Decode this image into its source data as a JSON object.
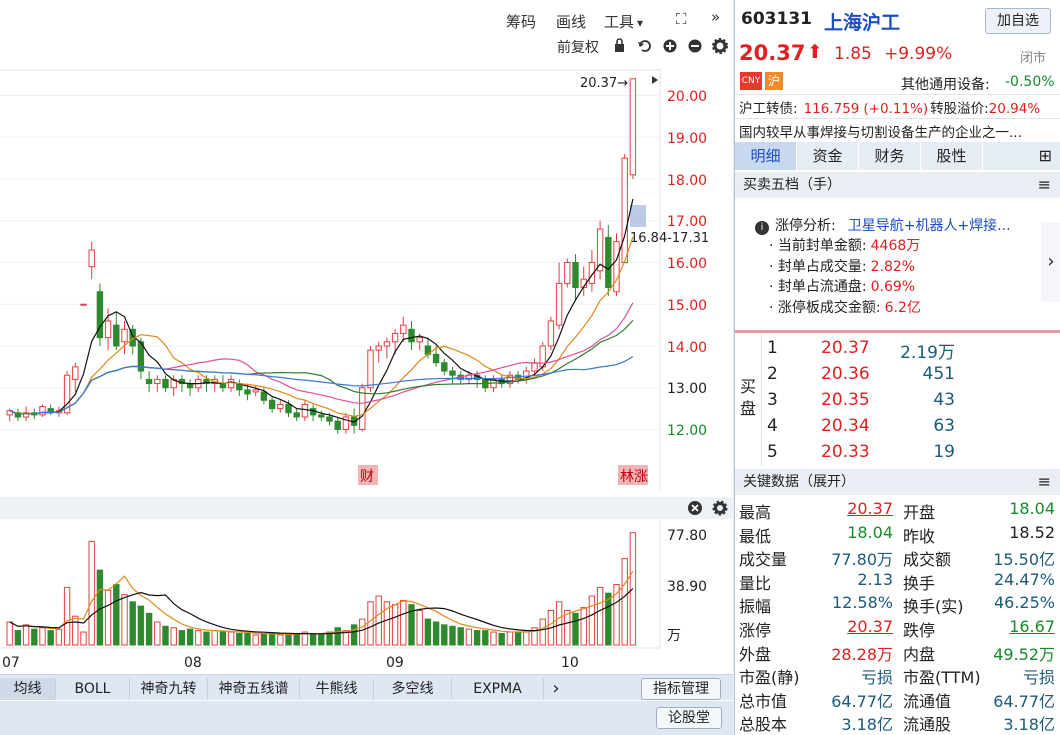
{
  "toolbar": {
    "chips": "筹码",
    "draw": "画线",
    "tools": "工具",
    "tools_arrow": "▾",
    "expand_icon": "⛶",
    "more_icon": "»",
    "adjust": "前复权"
  },
  "chart": {
    "y_labels": [
      "20.00",
      "19.00",
      "18.00",
      "17.00",
      "16.00",
      "15.00",
      "14.00",
      "13.00",
      "12.00"
    ],
    "last_price_tag": "20.37→",
    "range_tag": "16.84-17.31",
    "markers": [
      {
        "text": "财"
      },
      {
        "text": "林涨"
      }
    ],
    "volume_labels": [
      "77.80",
      "38.90",
      "万"
    ],
    "x_labels": [
      "07",
      "08",
      "09",
      "10"
    ],
    "chart_data": {
      "type": "candlestick",
      "title": "",
      "ylim": [
        11.6,
        20.5
      ],
      "volume_ylim": [
        0,
        77.8
      ],
      "candles": [
        [
          12.35,
          12.45,
          12.2,
          12.5,
          16
        ],
        [
          12.4,
          12.3,
          12.2,
          12.5,
          10
        ],
        [
          12.3,
          12.4,
          12.2,
          12.55,
          14
        ],
        [
          12.4,
          12.35,
          12.25,
          12.5,
          11
        ],
        [
          12.35,
          12.55,
          12.3,
          12.6,
          12
        ],
        [
          12.5,
          12.4,
          12.35,
          12.6,
          10
        ],
        [
          12.4,
          12.45,
          12.3,
          12.55,
          11
        ],
        [
          12.4,
          13.3,
          12.35,
          13.4,
          40
        ],
        [
          13.2,
          13.5,
          12.9,
          13.6,
          20
        ],
        [
          15,
          15,
          15,
          15,
          9
        ],
        [
          15.9,
          16.3,
          15.6,
          16.5,
          72
        ],
        [
          15.3,
          14.2,
          14.0,
          15.5,
          52
        ],
        [
          14.2,
          14.6,
          13.9,
          14.9,
          38
        ],
        [
          14.5,
          14.0,
          13.9,
          14.8,
          42
        ],
        [
          14.1,
          14.4,
          13.8,
          14.6,
          35
        ],
        [
          14.4,
          14.0,
          13.8,
          14.5,
          30
        ],
        [
          14.1,
          13.4,
          13.2,
          14.2,
          27
        ],
        [
          13.2,
          13.1,
          12.9,
          13.4,
          22
        ],
        [
          13.1,
          13.2,
          12.9,
          13.3,
          16
        ],
        [
          13.2,
          13.0,
          12.9,
          13.3,
          13
        ],
        [
          13.0,
          13.2,
          12.8,
          13.3,
          12
        ],
        [
          13.2,
          13.1,
          12.9,
          13.3,
          10
        ],
        [
          13.1,
          13.0,
          12.8,
          13.2,
          11
        ],
        [
          13.0,
          13.2,
          12.9,
          13.3,
          10
        ],
        [
          13.2,
          13.1,
          12.9,
          13.3,
          9
        ],
        [
          13.1,
          13.2,
          12.9,
          13.3,
          10
        ],
        [
          13.1,
          13.0,
          12.9,
          13.3,
          9
        ],
        [
          13.0,
          13.2,
          12.9,
          13.3,
          9
        ],
        [
          13.1,
          12.95,
          12.8,
          13.2,
          8
        ],
        [
          12.95,
          12.85,
          12.7,
          13.1,
          8
        ],
        [
          12.9,
          12.95,
          12.8,
          13.05,
          7
        ],
        [
          12.9,
          12.7,
          12.6,
          13.0,
          8
        ],
        [
          12.7,
          12.5,
          12.4,
          12.8,
          8
        ],
        [
          12.5,
          12.6,
          12.4,
          12.7,
          7
        ],
        [
          12.6,
          12.4,
          12.3,
          12.7,
          7
        ],
        [
          12.4,
          12.3,
          12.2,
          12.5,
          8
        ],
        [
          12.3,
          12.6,
          12.2,
          12.7,
          9
        ],
        [
          12.5,
          12.35,
          12.2,
          12.6,
          8
        ],
        [
          12.35,
          12.3,
          12.2,
          12.45,
          8
        ],
        [
          12.3,
          12.2,
          12.1,
          12.4,
          9
        ],
        [
          12.2,
          12.0,
          11.9,
          12.3,
          12
        ],
        [
          12.0,
          12.3,
          11.9,
          12.4,
          10
        ],
        [
          12.3,
          12.1,
          11.9,
          12.5,
          14
        ],
        [
          12.0,
          13.0,
          11.95,
          13.1,
          18
        ],
        [
          13.0,
          13.9,
          12.9,
          14.0,
          30
        ],
        [
          13.9,
          14.0,
          13.6,
          14.1,
          34
        ],
        [
          14.0,
          14.1,
          13.7,
          14.2,
          30
        ],
        [
          14.1,
          14.3,
          13.8,
          14.4,
          28
        ],
        [
          14.3,
          14.5,
          14.1,
          14.7,
          31
        ],
        [
          14.4,
          14.1,
          13.9,
          14.6,
          28
        ],
        [
          14.1,
          14.2,
          13.9,
          14.3,
          24
        ],
        [
          14.0,
          13.8,
          13.7,
          14.2,
          18
        ],
        [
          13.8,
          13.6,
          13.5,
          14.0,
          16
        ],
        [
          13.6,
          13.4,
          13.3,
          13.7,
          14
        ],
        [
          13.4,
          13.3,
          13.1,
          13.5,
          13
        ],
        [
          13.3,
          13.2,
          13.1,
          13.4,
          12
        ],
        [
          13.2,
          13.3,
          13.1,
          13.4,
          11
        ],
        [
          13.3,
          13.2,
          13.0,
          13.4,
          10
        ],
        [
          13.2,
          13.0,
          12.9,
          13.3,
          10
        ],
        [
          13.0,
          13.2,
          12.9,
          13.3,
          9
        ],
        [
          13.2,
          13.1,
          13.0,
          13.3,
          8
        ],
        [
          13.1,
          13.3,
          13.0,
          13.4,
          9
        ],
        [
          13.3,
          13.2,
          13.1,
          13.4,
          9
        ],
        [
          13.2,
          13.4,
          13.1,
          13.5,
          10
        ],
        [
          13.4,
          13.6,
          13.3,
          13.7,
          12
        ],
        [
          13.5,
          14.0,
          13.4,
          14.1,
          18
        ],
        [
          14.0,
          14.6,
          13.9,
          14.7,
          24
        ],
        [
          14.5,
          15.5,
          14.4,
          16.0,
          30
        ],
        [
          15.5,
          16.0,
          15.4,
          16.1,
          24
        ],
        [
          16.0,
          15.4,
          15.1,
          16.2,
          22
        ],
        [
          15.4,
          15.6,
          15.2,
          15.9,
          26
        ],
        [
          15.5,
          16.0,
          15.3,
          16.3,
          34
        ],
        [
          15.8,
          16.8,
          15.6,
          17.0,
          40
        ],
        [
          16.6,
          15.4,
          15.2,
          16.9,
          36
        ],
        [
          15.3,
          16.5,
          15.2,
          16.7,
          42
        ],
        [
          16.0,
          18.5,
          17.3,
          18.6,
          60
        ],
        [
          18.1,
          20.4,
          18.0,
          20.4,
          78
        ]
      ],
      "ma_series": [
        {
          "name": "MA5",
          "color": "#111111"
        },
        {
          "name": "MA10",
          "color": "#e08a1a"
        },
        {
          "name": "MA20",
          "color": "#e0509a"
        },
        {
          "name": "MA30",
          "color": "#2e7d32"
        },
        {
          "name": "MA60",
          "color": "#3b7bd0"
        }
      ]
    }
  },
  "tabs": [
    "均线",
    "BOLL",
    "神奇九转",
    "神奇五线谱",
    "牛熊线",
    "多空线",
    "EXPMA"
  ],
  "tabs_next": "›",
  "indicator_manage": "指标管理",
  "forum": "论股堂",
  "quote": {
    "code": "603131",
    "name": "上海沪工",
    "add_button": "加自选",
    "price": "20.37",
    "arrow": "⬆",
    "change": "1.85",
    "change_pct": "+9.99%",
    "status": "闭市",
    "badge_cny": "CNY",
    "badge_hu": "沪",
    "sector": "其他通用设备:",
    "sector_pct": "-0.50%",
    "bond": "沪工转债:",
    "bond_price": "116.759",
    "bond_pct": "(+0.11%)",
    "premium_label": "转股溢价:",
    "premium": "20.94%",
    "desc": "国内较早从事焊接与切割设备生产的企业之一...",
    "nav": [
      "明细",
      "资金",
      "财务",
      "股性"
    ],
    "grid_icon": "⊞"
  },
  "orderbook": {
    "title": "买卖五档（手）",
    "menu_icon": "≡",
    "info_icon": "❶",
    "analysis_label": "涨停分析:",
    "analysis_value": "卫星导航+机器人+焊接...",
    "lines": [
      {
        "k": "· 当前封单金额:",
        "v": "4468万"
      },
      {
        "k": "· 封单占成交量:",
        "v": "2.82%"
      },
      {
        "k": "· 封单占流通盘:",
        "v": "0.69%"
      },
      {
        "k": "· 涨停板成交金额:",
        "v": "6.2亿"
      }
    ],
    "side_label": "买盘",
    "bids": [
      {
        "level": "1",
        "price": "20.37",
        "vol": "2.19万"
      },
      {
        "level": "2",
        "price": "20.36",
        "vol": "451"
      },
      {
        "level": "3",
        "price": "20.35",
        "vol": "43"
      },
      {
        "level": "4",
        "price": "20.34",
        "vol": "63"
      },
      {
        "level": "5",
        "price": "20.33",
        "vol": "19"
      }
    ]
  },
  "keydata": {
    "title": "关键数据（展开）",
    "rows": [
      {
        "k1": "最高",
        "v1": "20.37",
        "c1": "red",
        "u1": true,
        "k2": "开盘",
        "v2": "18.04",
        "c2": "green"
      },
      {
        "k1": "最低",
        "v1": "18.04",
        "c1": "green",
        "k2": "昨收",
        "v2": "18.52",
        "c2": "dark"
      },
      {
        "k1": "成交量",
        "v1": "77.80万",
        "c1": "teal",
        "k2": "成交额",
        "v2": "15.50亿",
        "c2": "teal"
      },
      {
        "k1": "量比",
        "v1": "2.13",
        "c1": "teal",
        "k2": "换手",
        "v2": "24.47%",
        "c2": "teal"
      },
      {
        "k1": "振幅",
        "v1": "12.58%",
        "c1": "teal",
        "k2": "换手(实)",
        "v2": "46.25%",
        "c2": "teal"
      },
      {
        "k1": "涨停",
        "v1": "20.37",
        "c1": "red",
        "u1": true,
        "k2": "跌停",
        "v2": "16.67",
        "c2": "green",
        "u2": true
      },
      {
        "k1": "外盘",
        "v1": "28.28万",
        "c1": "red",
        "k2": "内盘",
        "v2": "49.52万",
        "c2": "green"
      },
      {
        "k1": "市盈(静)",
        "v1": "亏损",
        "c1": "teal",
        "k2": "市盈(TTM)",
        "v2": "亏损",
        "c2": "teal"
      },
      {
        "k1": "总市值",
        "v1": "64.77亿",
        "c1": "teal",
        "k2": "流通值",
        "v2": "64.77亿",
        "c2": "teal"
      },
      {
        "k1": "总股本",
        "v1": "3.18亿",
        "c1": "teal",
        "k2": "流通股",
        "v2": "3.18亿",
        "c2": "teal"
      }
    ]
  }
}
